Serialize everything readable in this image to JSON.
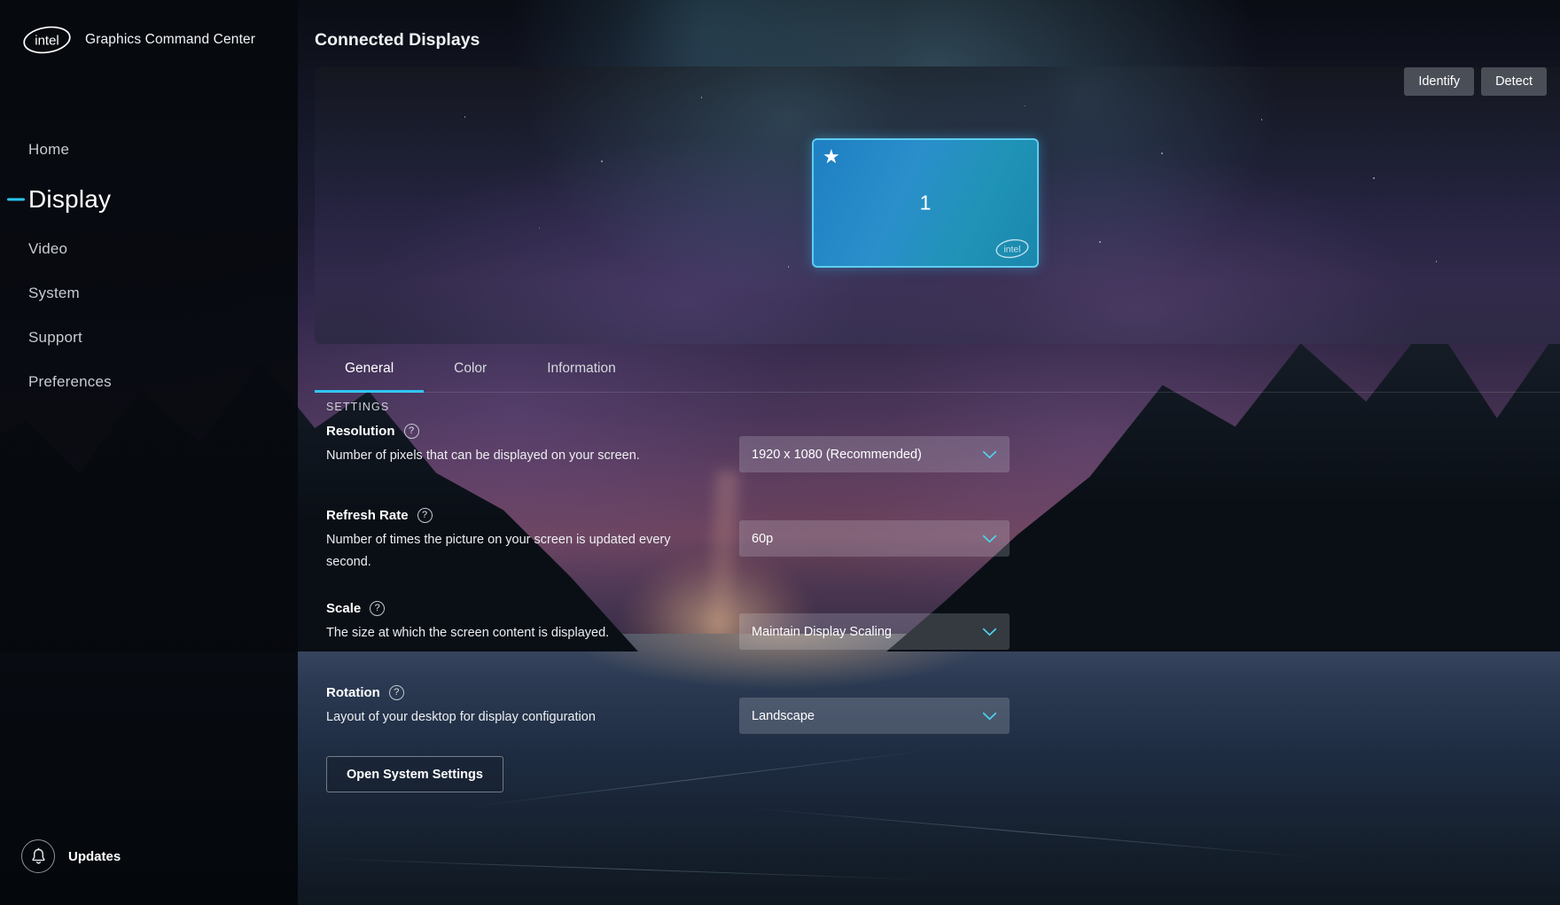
{
  "app": {
    "brand_title": "Graphics Command Center",
    "logo_text": "intel"
  },
  "sidebar": {
    "items": [
      {
        "label": "Home",
        "active": false
      },
      {
        "label": "Display",
        "active": true
      },
      {
        "label": "Video",
        "active": false
      },
      {
        "label": "System",
        "active": false
      },
      {
        "label": "Support",
        "active": false
      },
      {
        "label": "Preferences",
        "active": false
      }
    ],
    "updates": {
      "label": "Updates",
      "icon": "bell-icon"
    },
    "active_indicator_color": "#29c5f6"
  },
  "main": {
    "page_title": "Connected Displays",
    "preview_buttons": [
      {
        "label": "Identify",
        "name": "identify-button"
      },
      {
        "label": "Detect",
        "name": "detect-button"
      }
    ],
    "display_tile": {
      "number": "1",
      "primary_star": "★",
      "watermark": "intel"
    },
    "tabs": [
      {
        "label": "General",
        "active": true
      },
      {
        "label": "Color",
        "active": false
      },
      {
        "label": "Information",
        "active": false
      }
    ],
    "settings_header": "SETTINGS",
    "help_glyph": "?",
    "settings": [
      {
        "title": "Resolution",
        "description": "Number of pixels that can be displayed on your screen.",
        "value": "1920 x 1080 (Recommended)"
      },
      {
        "title": "Refresh Rate",
        "description": "Number of times the picture on your screen is updated every second.",
        "value": "60p"
      },
      {
        "title": "Scale",
        "description": "The size at which the screen content is displayed.",
        "value": "Maintain Display Scaling"
      },
      {
        "title": "Rotation",
        "description": "Layout of your desktop for display configuration",
        "value": "Landscape"
      }
    ],
    "open_system_settings": "Open System Settings"
  },
  "colors": {
    "accent_cyan": "#29c5f6",
    "tile_blue": "#1e7fc2",
    "tile_teal": "#1b87ad",
    "tile_border": "#5ecdf0"
  }
}
